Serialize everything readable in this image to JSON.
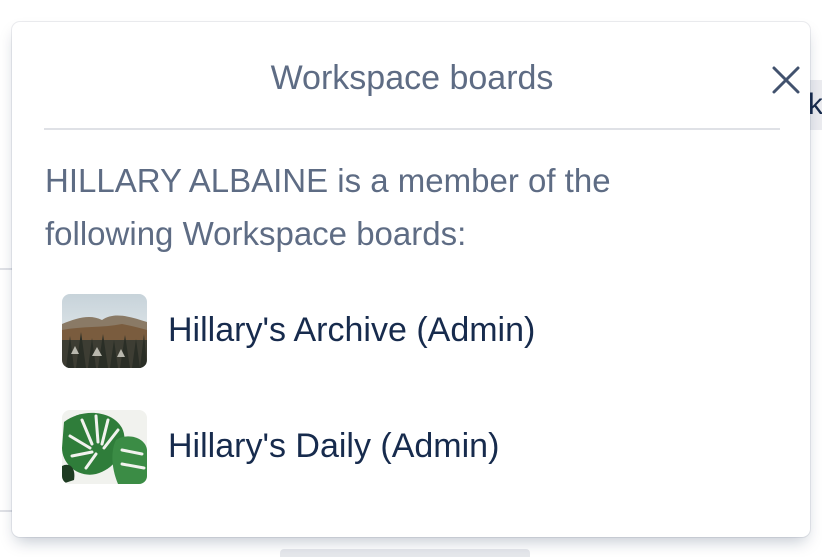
{
  "popover": {
    "title": "Workspace boards",
    "close_icon": "close-icon",
    "intro_text": "HILLARY ALBAINE is a member of the following Workspace boards:",
    "boards": [
      {
        "label": "Hillary's Archive (Admin)",
        "thumbnail": "mountain-forest-photo"
      },
      {
        "label": "Hillary's Daily (Admin)",
        "thumbnail": "monstera-leaf-photo"
      }
    ]
  },
  "background": {
    "peek_text": "k"
  },
  "colors": {
    "title": "#5e6c84",
    "text": "#172b4d",
    "divider": "#dfe1e6"
  }
}
